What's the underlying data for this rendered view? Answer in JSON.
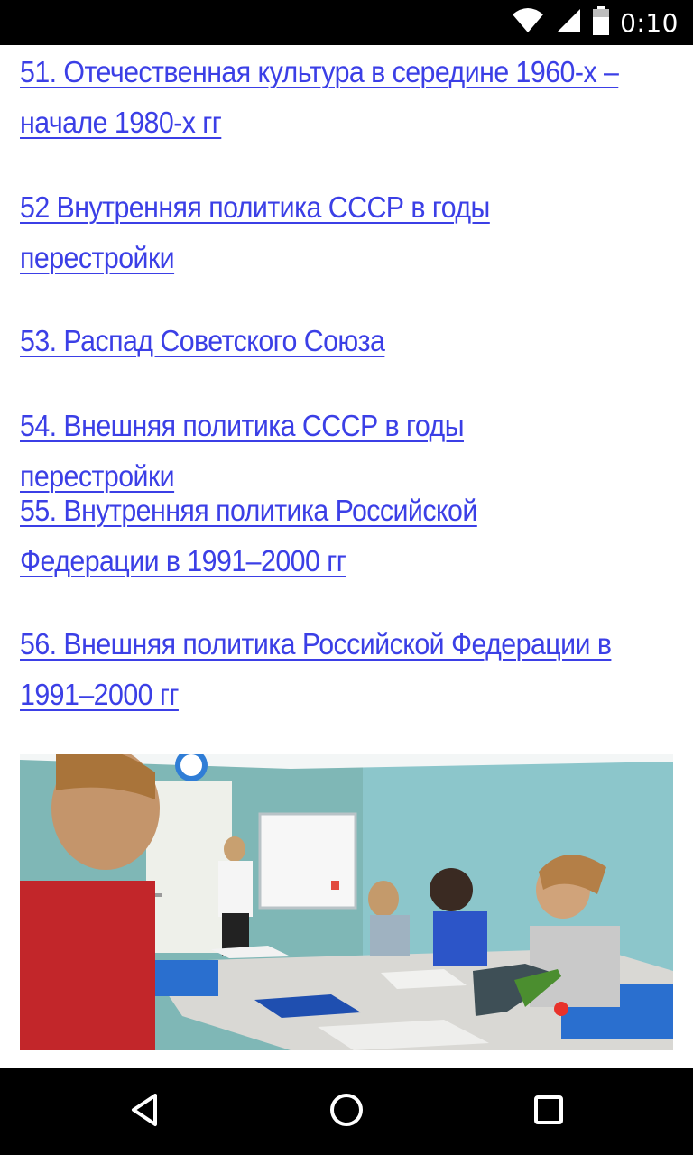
{
  "status_bar": {
    "time": "0:10",
    "icons": [
      "wifi-icon",
      "cell-signal-icon",
      "battery-icon"
    ]
  },
  "links": [
    {
      "text": "51. Отечественная культура в середине 1960-х – начале 1980-х гг"
    },
    {
      "text": "52 Внутренняя политика СССР в годы перестройки"
    },
    {
      "text": "53. Распад Советского Союза"
    },
    {
      "text": "54. Внешняя политика СССР в годы перестройки"
    },
    {
      "text": "55. Внутренняя политика Российской Федерации в 1991–2000 гг"
    },
    {
      "text": "56. Внешняя политика Российской Федерации в 1991–2000 гг"
    }
  ],
  "colors": {
    "link": "#3b3fe6",
    "status_bar": "#000000",
    "nav_bar": "#000000"
  },
  "photo": {
    "subject": "classroom-illustration"
  },
  "nav_bar": {
    "icons": [
      "back-icon",
      "home-icon",
      "recents-icon"
    ]
  }
}
